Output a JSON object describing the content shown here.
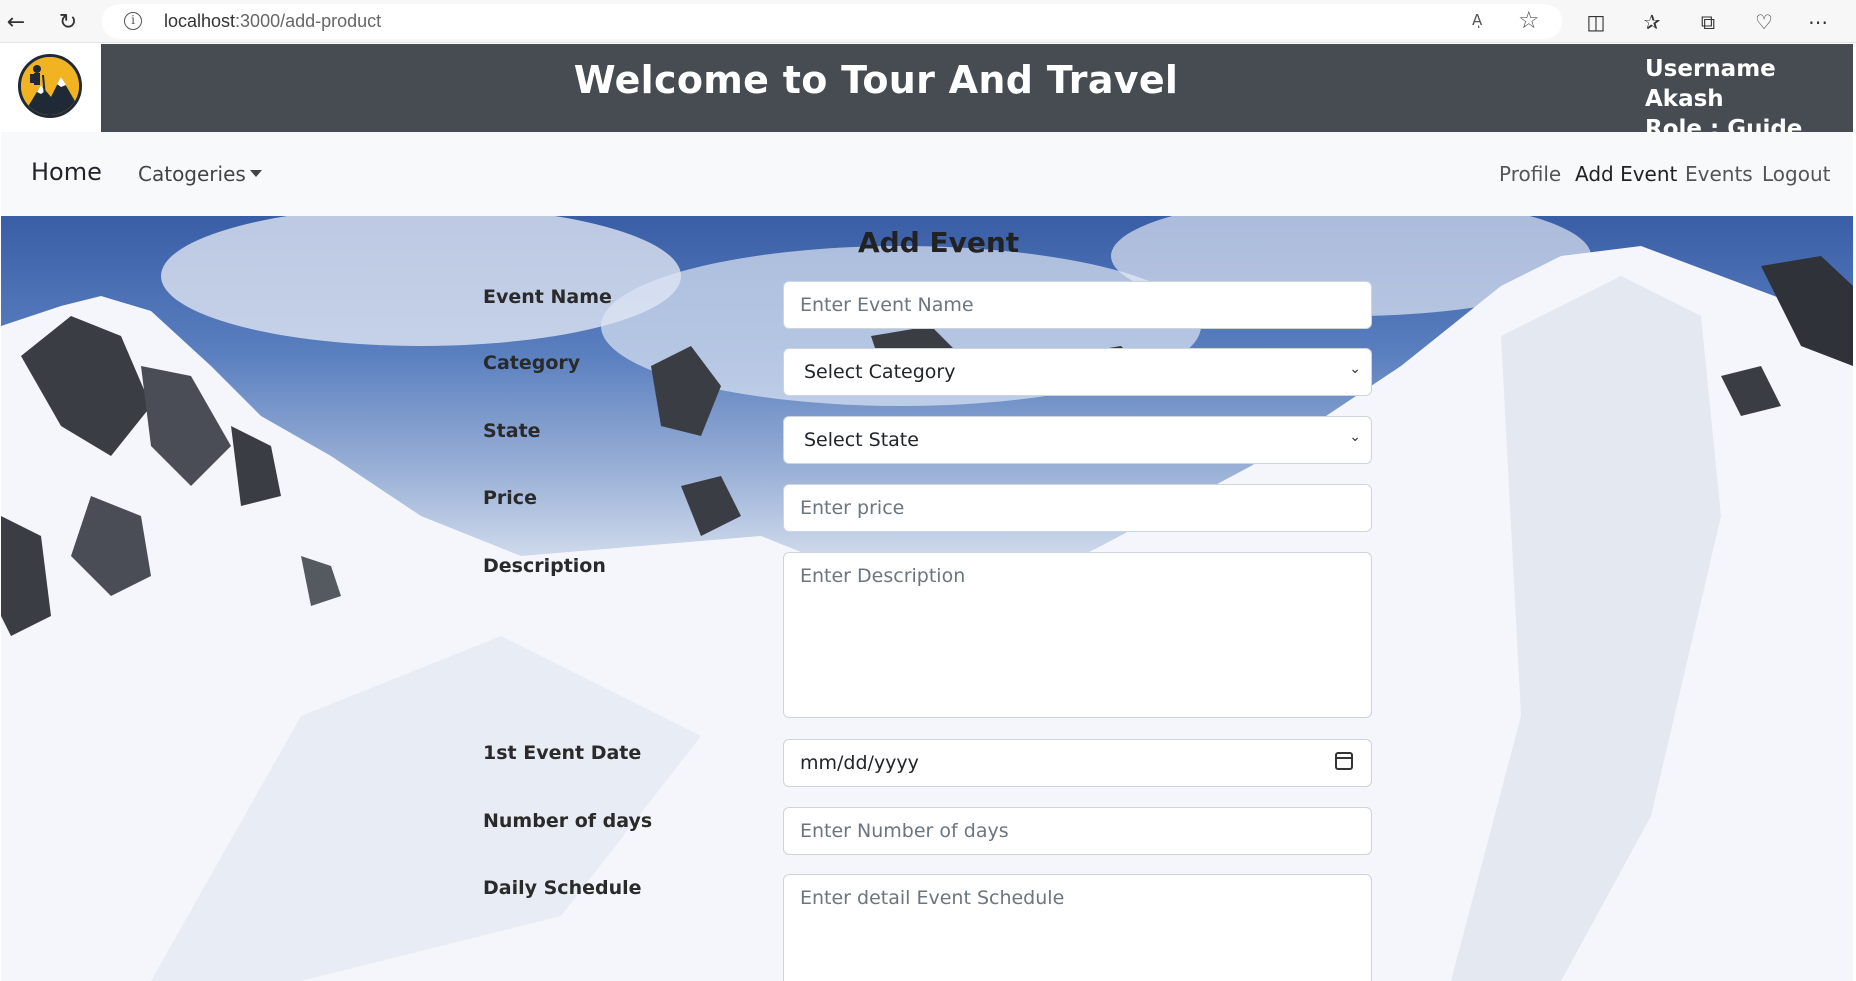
{
  "browser": {
    "url_host": "localhost",
    "url_rest": ":3000/add-product",
    "read_aloud": "Aͅ",
    "icons": [
      "back-icon",
      "refresh-icon",
      "info-icon",
      "read-aloud-icon",
      "favorite-star-icon",
      "split-screen-icon",
      "favorites-icon",
      "collections-icon",
      "browser-essentials-icon",
      "more-icon"
    ]
  },
  "header": {
    "title": "Welcome to Tour And Travel",
    "username_line": "Username Akash",
    "role_line": "Role : Guide"
  },
  "navbar": {
    "brand": "Home",
    "categories": "Catogeries",
    "links": [
      "Profile",
      "Add Event",
      "Events",
      "Logout"
    ],
    "active_link": "Add Event"
  },
  "form": {
    "title": "Add Event",
    "event_name": {
      "label": "Event Name",
      "placeholder": "Enter Event Name"
    },
    "category": {
      "label": "Category",
      "value": "Select Category"
    },
    "state": {
      "label": "State",
      "value": "Select State"
    },
    "price": {
      "label": "Price",
      "placeholder": "Enter price"
    },
    "description": {
      "label": "Description",
      "placeholder": "Enter Description"
    },
    "first_event_date": {
      "label": "1st Event Date",
      "value": "mm/dd/yyyy"
    },
    "number_of_days": {
      "label": "Number of days",
      "placeholder": "Enter Number of days"
    },
    "daily_schedule": {
      "label": "Daily Schedule",
      "placeholder": "Enter detail Event Schedule"
    }
  },
  "colors": {
    "banner": "#474c52",
    "navbar": "#f8f9fa",
    "logo": "#f1b322"
  }
}
